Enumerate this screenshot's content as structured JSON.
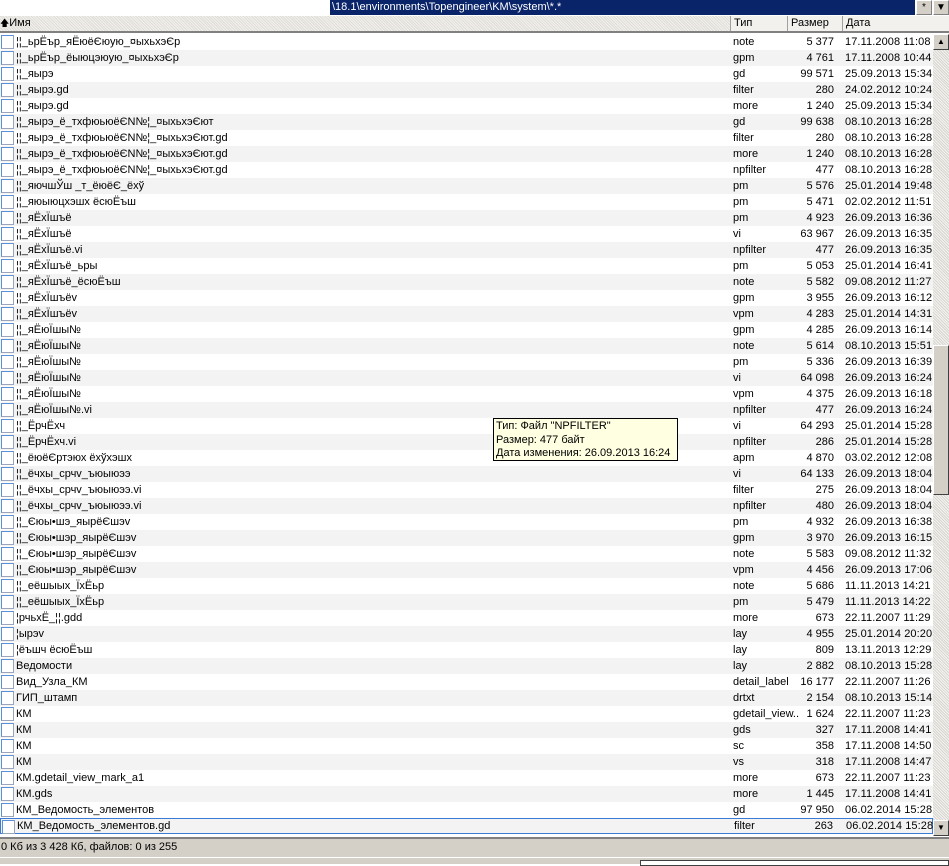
{
  "path": "\\18.1\\environments\\Topengineer\\KM\\system\\*.*",
  "path_buttons": [
    "*",
    "▼"
  ],
  "columns": {
    "name": "Имя",
    "type": "Тип",
    "size": "Размер",
    "date": "Дата",
    "sort_icon": "arrow-up-icon"
  },
  "files": [
    [
      "¦¦_ьрЁър_яЁюёЄюую_¤ыхьхэЄр",
      "note",
      "5 377",
      "17.11.2008 11:08"
    ],
    [
      "¦¦_ьрЁър_ёыюцэюую_¤ыхьхэЄр",
      "gpm",
      "4 761",
      "17.11.2008 10:44"
    ],
    [
      "¦¦_яырэ",
      "gd",
      "99 571",
      "25.09.2013 15:34"
    ],
    [
      "¦¦_яырэ.gd",
      "filter",
      "280",
      "24.02.2012 10:24"
    ],
    [
      "¦¦_яырэ.gd",
      "more",
      "1 240",
      "25.09.2013 15:34"
    ],
    [
      "¦¦_яырэ_ё_тхфюьюёЄN№¦_¤ыхьхэЄют",
      "gd",
      "99 638",
      "08.10.2013 16:28"
    ],
    [
      "¦¦_яырэ_ё_тхфюьюёЄN№¦_¤ыхьхэЄют.gd",
      "filter",
      "280",
      "08.10.2013 16:28"
    ],
    [
      "¦¦_яырэ_ё_тхфюьюёЄN№¦_¤ыхьхэЄют.gd",
      "more",
      "1 240",
      "08.10.2013 16:28"
    ],
    [
      "¦¦_яырэ_ё_тхфюьюёЄN№¦_¤ыхьхэЄют.gd",
      "npfilter",
      "477",
      "08.10.2013 16:28"
    ],
    [
      "¦¦_яючшЎш _т_ёюёЄ_ёхў",
      "pm",
      "5 576",
      "25.01.2014 19:48"
    ],
    [
      "¦¦_яюыюцхэшх ёсюЁъш",
      "pm",
      "5 471",
      "02.02.2012 11:51"
    ],
    [
      "¦¦_яЁхЇшъё",
      "pm",
      "4 923",
      "26.09.2013 16:36"
    ],
    [
      "¦¦_яЁхЇшъё",
      "vi",
      "63 967",
      "26.09.2013 16:35"
    ],
    [
      "¦¦_яЁхЇшъё.vi",
      "npfilter",
      "477",
      "26.09.2013 16:35"
    ],
    [
      "¦¦_яЁхЇшъё_ьры",
      "pm",
      "5 053",
      "25.01.2014 16:41"
    ],
    [
      "¦¦_яЁхЇшъё_ёсюЁъш",
      "note",
      "5 582",
      "09.08.2012 11:27"
    ],
    [
      "¦¦_яЁхЇшъёv",
      "gpm",
      "3 955",
      "26.09.2013 16:12"
    ],
    [
      "¦¦_яЁхЇшъёv",
      "vpm",
      "4 283",
      "25.01.2014 14:31"
    ],
    [
      "¦¦_яЁюЇшы№",
      "gpm",
      "4 285",
      "26.09.2013 16:14"
    ],
    [
      "¦¦_яЁюЇшы№",
      "note",
      "5 614",
      "08.10.2013 15:51"
    ],
    [
      "¦¦_яЁюЇшы№",
      "pm",
      "5 336",
      "26.09.2013 16:39"
    ],
    [
      "¦¦_яЁюЇшы№",
      "vi",
      "64 098",
      "26.09.2013 16:24"
    ],
    [
      "¦¦_яЁюЇшы№",
      "vpm",
      "4 375",
      "26.09.2013 16:18"
    ],
    [
      "¦¦_яЁюЇшы№.vi",
      "npfilter",
      "477",
      "26.09.2013 16:24"
    ],
    [
      "¦¦_ЁрчЁхч",
      "vi",
      "64 293",
      "25.01.2014 15:28"
    ],
    [
      "¦¦_ЁрчЁхч.vi",
      "npfilter",
      "286",
      "25.01.2014 15:28"
    ],
    [
      "¦¦_ёюёЄртэюх ёхўхэшх",
      "apm",
      "4 870",
      "03.02.2012 12:08"
    ],
    [
      "¦¦_ёчхы_срчv_ъюыюээ",
      "vi",
      "64 133",
      "26.09.2013 18:04"
    ],
    [
      "¦¦_ёчхы_срчv_ъюыюээ.vi",
      "filter",
      "275",
      "26.09.2013 18:04"
    ],
    [
      "¦¦_ёчхы_срчv_ъюыюээ.vi",
      "npfilter",
      "480",
      "26.09.2013 18:04"
    ],
    [
      "¦¦_Єюы•шэ_яырёЄшэv",
      "pm",
      "4 932",
      "26.09.2013 16:38"
    ],
    [
      "¦¦_Єюы•шэр_яырёЄшэv",
      "gpm",
      "3 970",
      "26.09.2013 16:15"
    ],
    [
      "¦¦_Єюы•шэр_яырёЄшэv",
      "note",
      "5 583",
      "09.08.2012 11:32"
    ],
    [
      "¦¦_Єюы•шэр_яырёЄшэv",
      "vpm",
      "4 456",
      "26.09.2013 17:06"
    ],
    [
      "¦¦_еёшыых_ЇхЁьр",
      "note",
      "5 686",
      "11.11.2013 14:21"
    ],
    [
      "¦¦_еёшыых_ЇхЁьр",
      "pm",
      "5 479",
      "11.11.2013 14:22"
    ],
    [
      "¦рчьхЁ_¦¦.gdd",
      "more",
      "673",
      "22.11.2007 11:29"
    ],
    [
      "¦ырэv",
      "lay",
      "4 955",
      "25.01.2014 20:20"
    ],
    [
      "¦ёъшч ёсюЁъш",
      "lay",
      "809",
      "13.11.2013 12:29"
    ],
    [
      "Ведомости",
      "lay",
      "2 882",
      "08.10.2013 15:28"
    ],
    [
      "Вид_Узла_КМ",
      "detail_label",
      "16 177",
      "22.11.2007 11:26"
    ],
    [
      "ГИП_штамп",
      "drtxt",
      "2 154",
      "08.10.2013 15:14"
    ],
    [
      "КМ",
      "gdetail_view..",
      "1 624",
      "22.11.2007 11:23"
    ],
    [
      "КМ",
      "gds",
      "327",
      "17.11.2008 14:41"
    ],
    [
      "КМ",
      "sc",
      "358",
      "17.11.2008 14:50"
    ],
    [
      "КМ",
      "vs",
      "318",
      "17.11.2008 14:47"
    ],
    [
      "КМ.gdetail_view_mark_a1",
      "more",
      "673",
      "22.11.2007 11:23"
    ],
    [
      "КМ.gds",
      "more",
      "1 445",
      "17.11.2008 14:41"
    ],
    [
      "КМ_Ведомость_элементов",
      "gd",
      "97 950",
      "06.02.2014 15:28"
    ],
    [
      "КМ_Ведомость_элементов.gd",
      "filter",
      "263",
      "06.02.2014 15:28"
    ]
  ],
  "focused_index": 49,
  "tooltip": {
    "type": "Тип: Файл \"NPFILTER\"",
    "size": "Размер: 477 байт",
    "date": "Дата изменения: 26.09.2013 16:24"
  },
  "status": "0 Кб из 3 428 Кб, файлов: 0 из 255",
  "scroll_icons": {
    "up": "▲",
    "down": "▼"
  }
}
